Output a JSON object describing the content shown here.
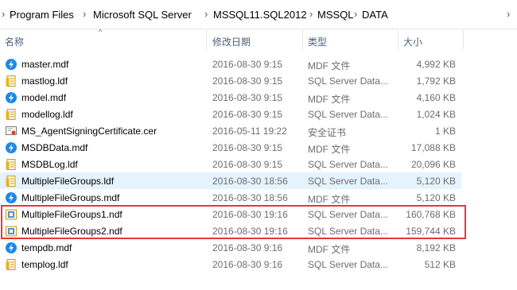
{
  "breadcrumb": [
    "Program Files",
    "Microsoft SQL Server",
    "MSSQL11.SQL2012",
    "MSSQL",
    "DATA"
  ],
  "columns": {
    "name": "名称",
    "date": "修改日期",
    "type": "类型",
    "size": "大小"
  },
  "files": [
    {
      "name": "master.mdf",
      "date": "2016-08-30 9:15",
      "type": "MDF 文件",
      "size": "4,992 KB",
      "icon": "sql-data-icon"
    },
    {
      "name": "mastlog.ldf",
      "date": "2016-08-30 9:15",
      "type": "SQL Server Data...",
      "size": "1,792 KB",
      "icon": "ldf-file-icon"
    },
    {
      "name": "model.mdf",
      "date": "2016-08-30 9:15",
      "type": "MDF 文件",
      "size": "4,160 KB",
      "icon": "sql-data-icon"
    },
    {
      "name": "modellog.ldf",
      "date": "2016-08-30 9:15",
      "type": "SQL Server Data...",
      "size": "1,024 KB",
      "icon": "ldf-file-icon"
    },
    {
      "name": "MS_AgentSigningCertificate.cer",
      "date": "2016-05-11 19:22",
      "type": "安全证书",
      "size": "1 KB",
      "icon": "certificate-icon"
    },
    {
      "name": "MSDBData.mdf",
      "date": "2016-08-30 9:15",
      "type": "MDF 文件",
      "size": "17,088 KB",
      "icon": "sql-data-icon"
    },
    {
      "name": "MSDBLog.ldf",
      "date": "2016-08-30 9:15",
      "type": "SQL Server Data...",
      "size": "20,096 KB",
      "icon": "ldf-file-icon"
    },
    {
      "name": "MultipleFileGroups.ldf",
      "date": "2016-08-30 18:56",
      "type": "SQL Server Data...",
      "size": "5,120 KB",
      "icon": "ldf-file-icon"
    },
    {
      "name": "MultipleFileGroups.mdf",
      "date": "2016-08-30 18:56",
      "type": "MDF 文件",
      "size": "5,120 KB",
      "icon": "sql-data-icon"
    },
    {
      "name": "MultipleFileGroups1.ndf",
      "date": "2016-08-30 19:16",
      "type": "SQL Server Data...",
      "size": "160,768 KB",
      "icon": "ndf-file-icon"
    },
    {
      "name": "MultipleFileGroups2.ndf",
      "date": "2016-08-30 19:16",
      "type": "SQL Server Data...",
      "size": "159,744 KB",
      "icon": "ndf-file-icon"
    },
    {
      "name": "tempdb.mdf",
      "date": "2016-08-30 9:16",
      "type": "MDF 文件",
      "size": "8,192 KB",
      "icon": "sql-data-icon"
    },
    {
      "name": "templog.ldf",
      "date": "2016-08-30 9:16",
      "type": "SQL Server Data...",
      "size": "512 KB",
      "icon": "ldf-file-icon"
    }
  ],
  "hovered_file": "MultipleFileGroups.ldf",
  "highlighted_files": [
    "MultipleFileGroups1.ndf",
    "MultipleFileGroups2.ndf"
  ],
  "colors": {
    "highlight_border": "#e53935",
    "hover_row": "#e5f3ff",
    "sql_icon": "#1e88e5"
  }
}
